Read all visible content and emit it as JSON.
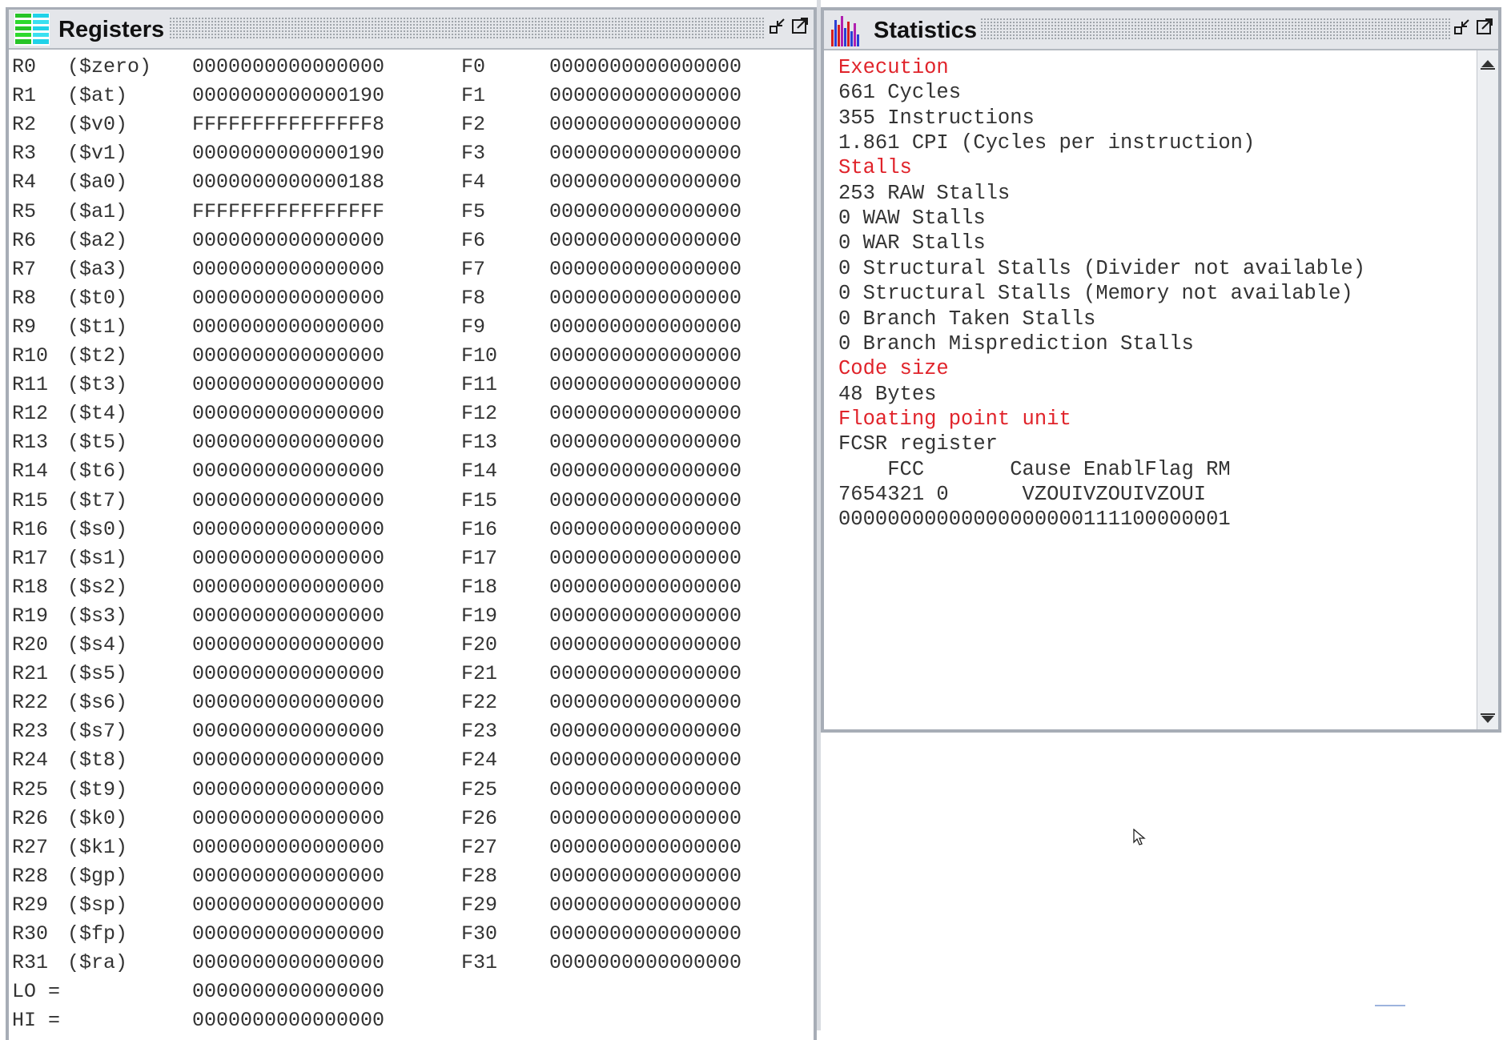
{
  "registers_window": {
    "title": "Registers",
    "icon": "registers-icon",
    "rows": [
      {
        "r": "R0",
        "alias": "($zero)",
        "rval": "0000000000000000",
        "f": "F0",
        "fval": "0000000000000000"
      },
      {
        "r": "R1",
        "alias": "($at)",
        "rval": "0000000000000190",
        "f": "F1",
        "fval": "0000000000000000"
      },
      {
        "r": "R2",
        "alias": "($v0)",
        "rval": "FFFFFFFFFFFFFFF8",
        "f": "F2",
        "fval": "0000000000000000"
      },
      {
        "r": "R3",
        "alias": "($v1)",
        "rval": "0000000000000190",
        "f": "F3",
        "fval": "0000000000000000"
      },
      {
        "r": "R4",
        "alias": "($a0)",
        "rval": "0000000000000188",
        "f": "F4",
        "fval": "0000000000000000"
      },
      {
        "r": "R5",
        "alias": "($a1)",
        "rval": "FFFFFFFFFFFFFFFF",
        "f": "F5",
        "fval": "0000000000000000"
      },
      {
        "r": "R6",
        "alias": "($a2)",
        "rval": "0000000000000000",
        "f": "F6",
        "fval": "0000000000000000"
      },
      {
        "r": "R7",
        "alias": "($a3)",
        "rval": "0000000000000000",
        "f": "F7",
        "fval": "0000000000000000"
      },
      {
        "r": "R8",
        "alias": "($t0)",
        "rval": "0000000000000000",
        "f": "F8",
        "fval": "0000000000000000"
      },
      {
        "r": "R9",
        "alias": "($t1)",
        "rval": "0000000000000000",
        "f": "F9",
        "fval": "0000000000000000"
      },
      {
        "r": "R10",
        "alias": "($t2)",
        "rval": "0000000000000000",
        "f": "F10",
        "fval": "0000000000000000"
      },
      {
        "r": "R11",
        "alias": "($t3)",
        "rval": "0000000000000000",
        "f": "F11",
        "fval": "0000000000000000"
      },
      {
        "r": "R12",
        "alias": "($t4)",
        "rval": "0000000000000000",
        "f": "F12",
        "fval": "0000000000000000"
      },
      {
        "r": "R13",
        "alias": "($t5)",
        "rval": "0000000000000000",
        "f": "F13",
        "fval": "0000000000000000"
      },
      {
        "r": "R14",
        "alias": "($t6)",
        "rval": "0000000000000000",
        "f": "F14",
        "fval": "0000000000000000"
      },
      {
        "r": "R15",
        "alias": "($t7)",
        "rval": "0000000000000000",
        "f": "F15",
        "fval": "0000000000000000"
      },
      {
        "r": "R16",
        "alias": "($s0)",
        "rval": "0000000000000000",
        "f": "F16",
        "fval": "0000000000000000"
      },
      {
        "r": "R17",
        "alias": "($s1)",
        "rval": "0000000000000000",
        "f": "F17",
        "fval": "0000000000000000"
      },
      {
        "r": "R18",
        "alias": "($s2)",
        "rval": "0000000000000000",
        "f": "F18",
        "fval": "0000000000000000"
      },
      {
        "r": "R19",
        "alias": "($s3)",
        "rval": "0000000000000000",
        "f": "F19",
        "fval": "0000000000000000"
      },
      {
        "r": "R20",
        "alias": "($s4)",
        "rval": "0000000000000000",
        "f": "F20",
        "fval": "0000000000000000"
      },
      {
        "r": "R21",
        "alias": "($s5)",
        "rval": "0000000000000000",
        "f": "F21",
        "fval": "0000000000000000"
      },
      {
        "r": "R22",
        "alias": "($s6)",
        "rval": "0000000000000000",
        "f": "F22",
        "fval": "0000000000000000"
      },
      {
        "r": "R23",
        "alias": "($s7)",
        "rval": "0000000000000000",
        "f": "F23",
        "fval": "0000000000000000"
      },
      {
        "r": "R24",
        "alias": "($t8)",
        "rval": "0000000000000000",
        "f": "F24",
        "fval": "0000000000000000"
      },
      {
        "r": "R25",
        "alias": "($t9)",
        "rval": "0000000000000000",
        "f": "F25",
        "fval": "0000000000000000"
      },
      {
        "r": "R26",
        "alias": "($k0)",
        "rval": "0000000000000000",
        "f": "F26",
        "fval": "0000000000000000"
      },
      {
        "r": "R27",
        "alias": "($k1)",
        "rval": "0000000000000000",
        "f": "F27",
        "fval": "0000000000000000"
      },
      {
        "r": "R28",
        "alias": "($gp)",
        "rval": "0000000000000000",
        "f": "F28",
        "fval": "0000000000000000"
      },
      {
        "r": "R29",
        "alias": "($sp)",
        "rval": "0000000000000000",
        "f": "F29",
        "fval": "0000000000000000"
      },
      {
        "r": "R30",
        "alias": "($fp)",
        "rval": "0000000000000000",
        "f": "F30",
        "fval": "0000000000000000"
      },
      {
        "r": "R31",
        "alias": "($ra)",
        "rval": "0000000000000000",
        "f": "F31",
        "fval": "0000000000000000"
      }
    ],
    "lo_label": "LO =",
    "lo_value": "0000000000000000",
    "hi_label": "HI =",
    "hi_value": "0000000000000000"
  },
  "statistics_window": {
    "title": "Statistics",
    "icon": "statistics-icon",
    "lines": [
      {
        "text": "Execution",
        "kind": "head"
      },
      {
        "text": "661 Cycles",
        "kind": "text"
      },
      {
        "text": "355 Instructions",
        "kind": "text"
      },
      {
        "text": "1.861 CPI (Cycles per instruction)",
        "kind": "text"
      },
      {
        "text": "Stalls",
        "kind": "head"
      },
      {
        "text": "253 RAW Stalls",
        "kind": "text"
      },
      {
        "text": "0 WAW Stalls",
        "kind": "text"
      },
      {
        "text": "0 WAR Stalls",
        "kind": "text"
      },
      {
        "text": "0 Structural Stalls (Divider not available)",
        "kind": "text"
      },
      {
        "text": "0 Structural Stalls (Memory not available)",
        "kind": "text"
      },
      {
        "text": "0 Branch Taken Stalls",
        "kind": "text"
      },
      {
        "text": "0 Branch Misprediction Stalls",
        "kind": "text"
      },
      {
        "text": "Code size",
        "kind": "head"
      },
      {
        "text": "48 Bytes",
        "kind": "text"
      },
      {
        "text": "Floating point unit",
        "kind": "head"
      },
      {
        "text": "FCSR register",
        "kind": "text"
      },
      {
        "text": "    FCC       Cause EnablFlag RM",
        "kind": "text"
      },
      {
        "text": "7654321 0      VZOUIVZOUIVZOUI",
        "kind": "text"
      },
      {
        "text": "00000000000000000000111100000001",
        "kind": "text"
      }
    ]
  },
  "colors": {
    "heading": "#e0232a",
    "text": "#333333",
    "window_border": "#a7adb6",
    "titlebar": "#e4e6ea"
  }
}
